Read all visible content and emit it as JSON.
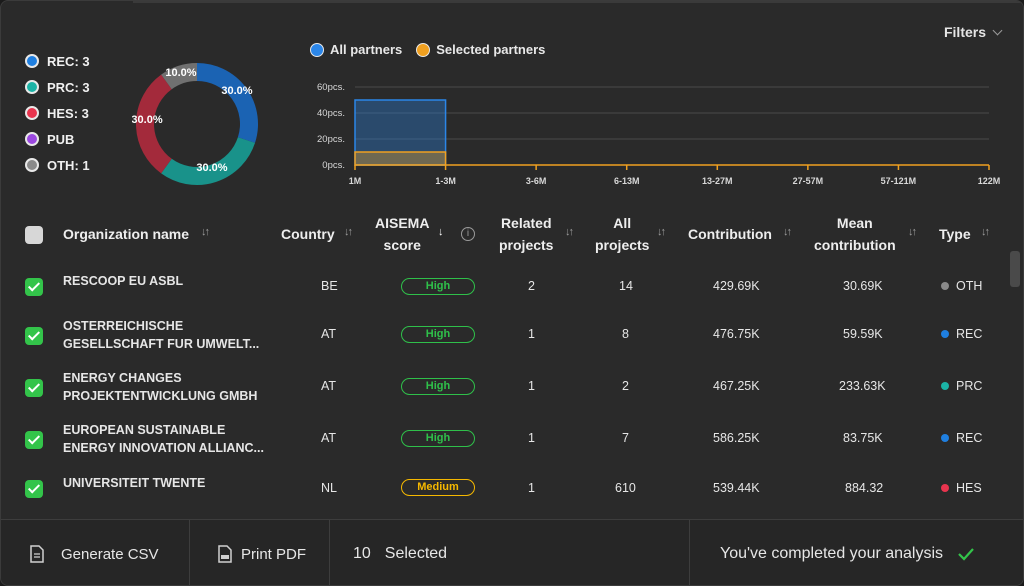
{
  "filters": {
    "label": "Filters"
  },
  "type_legend": [
    {
      "label": "REC: 3",
      "color": "#1f7fe0"
    },
    {
      "label": "PRC: 3",
      "color": "#1bb3a6"
    },
    {
      "label": "HES: 3",
      "color": "#e8344e"
    },
    {
      "label": "PUB",
      "color": "#9b48e0"
    },
    {
      "label": "OTH: 1",
      "color": "#8a8a8a"
    }
  ],
  "donut": {
    "labels": [
      "30.0%",
      "30.0%",
      "30.0%",
      "10.0%"
    ],
    "slices": [
      {
        "type": "REC",
        "percent": 30.0,
        "color": "#1b63b3"
      },
      {
        "type": "PRC",
        "percent": 30.0,
        "color": "#19928a"
      },
      {
        "type": "HES",
        "percent": 30.0,
        "color": "#a32a3b"
      },
      {
        "type": "OTH",
        "percent": 10.0,
        "color": "#707070"
      }
    ]
  },
  "chart_legend": {
    "all": {
      "label": "All partners",
      "color": "#2b86e8"
    },
    "selected": {
      "label": "Selected partners",
      "color": "#f0a020"
    }
  },
  "chart_data": {
    "type": "area",
    "x": [
      "1M",
      "1-3M",
      "3-6M",
      "6-13M",
      "13-27M",
      "27-57M",
      "57-121M",
      "122M"
    ],
    "y_ticks": [
      "60pcs.",
      "40pcs.",
      "20pcs.",
      "0pcs."
    ],
    "ylim": [
      0,
      60
    ],
    "series": [
      {
        "name": "All partners",
        "values": [
          50,
          0,
          0,
          0,
          0,
          0,
          0
        ]
      },
      {
        "name": "Selected partners",
        "values": [
          10,
          0,
          0,
          0,
          0,
          0,
          0
        ]
      }
    ]
  },
  "table": {
    "headers": {
      "org": "Organization name",
      "country": "Country",
      "aisema_1": "AISEMA",
      "aisema_2": "score",
      "related_1": "Related",
      "related_2": "projects",
      "all_1": "All",
      "all_2": "projects",
      "contribution": "Contribution",
      "mean_1": "Mean",
      "mean_2": "contribution",
      "type": "Type"
    },
    "rows": [
      {
        "name1": "RESCOOP EU ASBL",
        "name2": "",
        "country": "BE",
        "score": "High",
        "related": "2",
        "all": "14",
        "contribution": "429.69K",
        "mean": "30.69K",
        "type": "OTH",
        "color": "#8a8a8a"
      },
      {
        "name1": "OSTERREICHISCHE",
        "name2": "GESELLSCHAFT FUR UMWELT...",
        "country": "AT",
        "score": "High",
        "related": "1",
        "all": "8",
        "contribution": "476.75K",
        "mean": "59.59K",
        "type": "REC",
        "color": "#1f7fe0"
      },
      {
        "name1": "ENERGY CHANGES",
        "name2": "PROJEKTENTWICKLUNG GMBH",
        "country": "AT",
        "score": "High",
        "related": "1",
        "all": "2",
        "contribution": "467.25K",
        "mean": "233.63K",
        "type": "PRC",
        "color": "#1bb3a6"
      },
      {
        "name1": "EUROPEAN SUSTAINABLE",
        "name2": "ENERGY INNOVATION ALLIANC...",
        "country": "AT",
        "score": "High",
        "related": "1",
        "all": "7",
        "contribution": "586.25K",
        "mean": "83.75K",
        "type": "REC",
        "color": "#1f7fe0"
      },
      {
        "name1": "UNIVERSITEIT TWENTE",
        "name2": "",
        "country": "NL",
        "score": "Medium",
        "related": "1",
        "all": "610",
        "contribution": "539.44K",
        "mean": "884.32",
        "type": "HES",
        "color": "#e8344e"
      }
    ]
  },
  "footer": {
    "csv": "Generate CSV",
    "pdf": "Print PDF",
    "count": "10",
    "selected": "Selected",
    "complete": "You've completed your analysis"
  }
}
